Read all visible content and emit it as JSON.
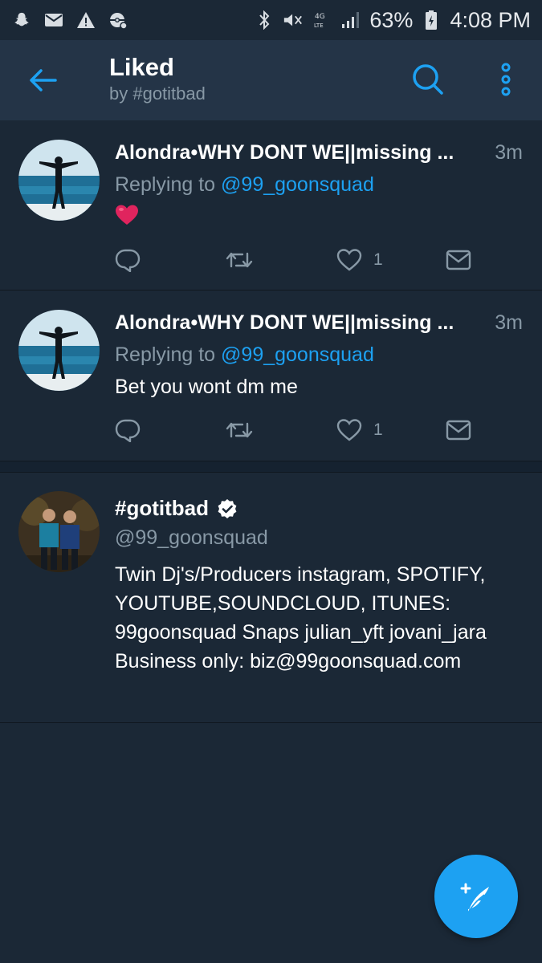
{
  "status_bar": {
    "battery": "63%",
    "time": "4:08 PM",
    "network": "4G LTE",
    "icons": [
      "snapchat-icon",
      "mail-icon",
      "warning-icon",
      "pokemon-icon",
      "bluetooth-icon",
      "mute-icon",
      "network-icon",
      "signal-icon",
      "battery-icon"
    ]
  },
  "header": {
    "title": "Liked",
    "subtitle": "by #gotitbad"
  },
  "tweets": [
    {
      "name": "Alondra•WHY DONT WE||missing ...",
      "time": "3m",
      "reply_prefix": "Replying to ",
      "reply_handle": "@99_goonsquad",
      "body": "",
      "emoji": "heart",
      "like_count": "1"
    },
    {
      "name": "Alondra•WHY DONT WE||missing ...",
      "time": "3m",
      "reply_prefix": "Replying to ",
      "reply_handle": "@99_goonsquad",
      "body": "Bet you wont dm me",
      "like_count": "1"
    }
  ],
  "profile": {
    "name": "#gotitbad",
    "verified": true,
    "handle": "@99_goonsquad",
    "bio": "Twin Dj's/Producers instagram, SPOTIFY, YOUTUBE,SOUNDCLOUD, ITUNES: 99goonsquad Snaps julian_yft jovani_jara Business only: biz@99goonsquad.com"
  },
  "colors": {
    "background": "#1b2836",
    "header": "#243447",
    "accent": "#1da1f2",
    "secondary_text": "#8899a6",
    "heart": "#e0245e"
  }
}
